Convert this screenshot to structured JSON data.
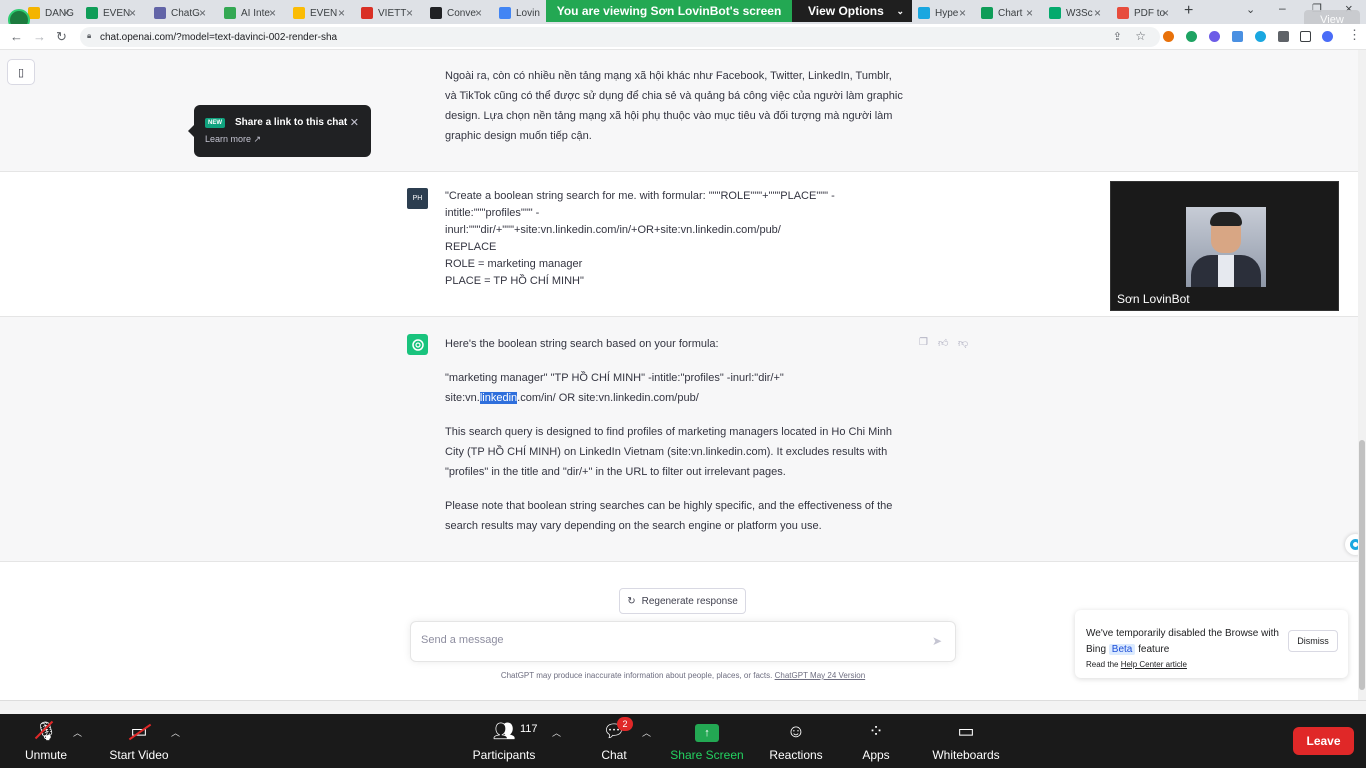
{
  "browser": {
    "tabs": [
      {
        "label": "DANG",
        "color": "#f4b400"
      },
      {
        "label": "EVEN",
        "color": "#0f9d58"
      },
      {
        "label": "ChatG",
        "color": "#6264a7"
      },
      {
        "label": "AI Inte",
        "color": "#34a853"
      },
      {
        "label": "EVEN",
        "color": "#fbbc04"
      },
      {
        "label": "VIETT",
        "color": "#d93025"
      },
      {
        "label": "Conve",
        "color": "#202124"
      },
      {
        "label": "Lovin",
        "color": "#4285f4"
      },
      {
        "label": "Hype",
        "color": "#1aa7e0"
      },
      {
        "label": "Chart",
        "color": "#0f9d58"
      },
      {
        "label": "W3Sc",
        "color": "#04aa6d"
      },
      {
        "label": "PDF to",
        "color": "#e74c3c"
      }
    ],
    "url": "chat.openai.com/?model=text-davinci-002-render-sha",
    "new_tab": "+",
    "view_chip": "View"
  },
  "zoom_banner": {
    "message": "You are viewing Sơn LovinBot's screen",
    "options_label": "View Options"
  },
  "share_tip": {
    "badge": "NEW",
    "title": "Share a link to this chat",
    "link": "Learn more"
  },
  "conversation": {
    "prev_answer_lines": [
      "Ngoài ra, còn có nhiều nền tảng mạng xã hội khác như Facebook, Twitter, LinkedIn, Tumblr,",
      "và TikTok cũng có thể được sử dụng để chia sẻ và quảng bá công việc của người làm graphic",
      "design. Lựa chọn nền tảng mạng xã hội phụ thuộc vào mục tiêu và đối tượng mà người làm",
      "graphic design muốn tiếp cận."
    ],
    "user_avatar": "PH",
    "user_lines": [
      "\"Create a boolean string search for me. with formular: \"\"\"ROLE\"\"\"+\"\"\"PLACE\"\"\" -",
      "intitle:\"\"\"profiles\"\"\" -",
      "inurl:\"\"\"dir/+\"\"\"+site:vn.linkedin.com/in/+OR+site:vn.linkedin.com/pub/",
      "REPLACE",
      "ROLE = marketing manager",
      "PLACE = TP HỒ CHÍ MINH\""
    ],
    "answer_intro": "Here's the boolean string search based on your formula:",
    "query_line1": "\"marketing manager\" \"TP HỒ CHÍ MINH\" -intitle:\"profiles\" -inurl:\"dir/+\"",
    "query_line2_pre": "site:vn.",
    "query_line2_hl": "linkedin",
    "query_line2_post": ".com/in/ OR site:vn.linkedin.com/pub/",
    "explain_lines": [
      "This search query is designed to find profiles of marketing managers located in Ho Chi Minh",
      "City (TP HỒ CHÍ MINH) on LinkedIn Vietnam (site:vn.linkedin.com). It excludes results with",
      "\"profiles\" in the title and \"dir/+\" in the URL to filter out irrelevant pages."
    ],
    "note_lines": [
      "Please note that boolean string searches can be highly specific, and the effectiveness of the",
      "search results may vary depending on the search engine or platform you use."
    ]
  },
  "video": {
    "name": "Sơn LovinBot"
  },
  "composer": {
    "regenerate": "Regenerate response",
    "placeholder": "Send a message",
    "disclaimer": "ChatGPT may produce inaccurate information about people, places, or facts.",
    "version_link": "ChatGPT May 24 Version"
  },
  "bing_notice": {
    "text_pre": "We've temporarily disabled the Browse with Bing",
    "beta": "Beta",
    "text_post": "feature",
    "read": "Read the",
    "link": "Help Center article",
    "dismiss": "Dismiss"
  },
  "zoom_controls": {
    "unmute": "Unmute",
    "start_video": "Start Video",
    "participants": "Participants",
    "participant_count": "117",
    "chat": "Chat",
    "chat_badge": "2",
    "share_screen": "Share Screen",
    "reactions": "Reactions",
    "apps": "Apps",
    "whiteboards": "Whiteboards",
    "leave": "Leave"
  }
}
